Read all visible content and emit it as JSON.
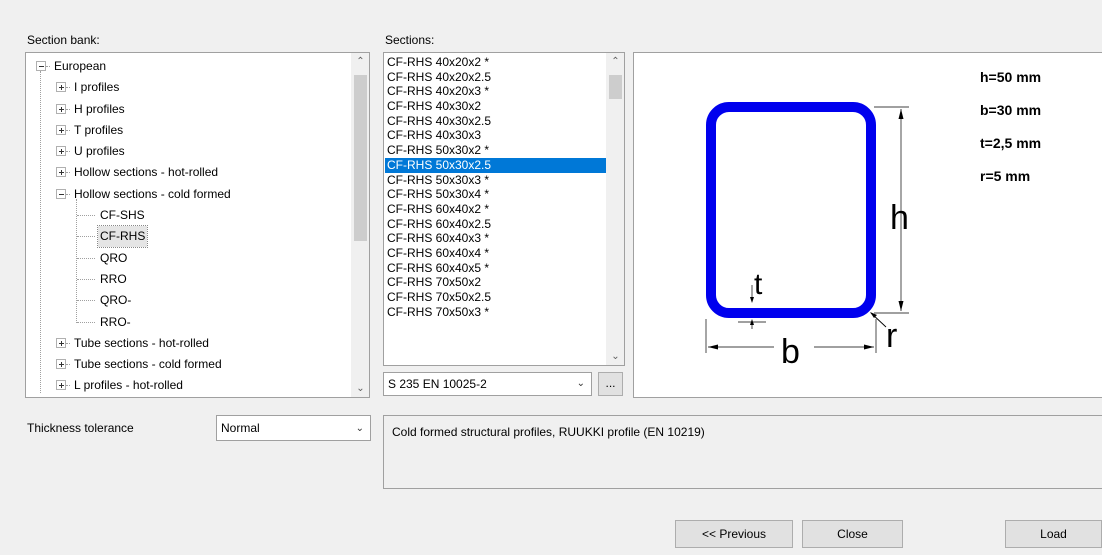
{
  "section_bank": {
    "label": "Section bank:",
    "tree": [
      {
        "label": "European",
        "level": 0,
        "toggle": "minus"
      },
      {
        "label": "I profiles",
        "level": 1,
        "toggle": "plus"
      },
      {
        "label": "H profiles",
        "level": 1,
        "toggle": "plus"
      },
      {
        "label": "T profiles",
        "level": 1,
        "toggle": "plus"
      },
      {
        "label": "U profiles",
        "level": 1,
        "toggle": "plus"
      },
      {
        "label": "Hollow sections - hot-rolled",
        "level": 1,
        "toggle": "plus"
      },
      {
        "label": "Hollow sections - cold formed",
        "level": 1,
        "toggle": "minus"
      },
      {
        "label": "CF-SHS",
        "level": 2,
        "toggle": "none"
      },
      {
        "label": "CF-RHS",
        "level": 2,
        "toggle": "none",
        "selected": true
      },
      {
        "label": "QRO",
        "level": 2,
        "toggle": "none"
      },
      {
        "label": "RRO",
        "level": 2,
        "toggle": "none"
      },
      {
        "label": "QRO-",
        "level": 2,
        "toggle": "none"
      },
      {
        "label": "RRO-",
        "level": 2,
        "toggle": "none"
      },
      {
        "label": "Tube sections - hot-rolled",
        "level": 1,
        "toggle": "plus"
      },
      {
        "label": "Tube sections - cold formed",
        "level": 1,
        "toggle": "plus"
      },
      {
        "label": "L profiles - hot-rolled",
        "level": 1,
        "toggle": "plus"
      }
    ]
  },
  "sections": {
    "label": "Sections:",
    "items": [
      "CF-RHS 40x20x2 *",
      "CF-RHS 40x20x2.5",
      "CF-RHS 40x20x3 *",
      "CF-RHS 40x30x2",
      "CF-RHS 40x30x2.5",
      "CF-RHS 40x30x3",
      "CF-RHS 50x30x2 *",
      "CF-RHS 50x30x2.5",
      "CF-RHS 50x30x3 *",
      "CF-RHS 50x30x4 *",
      "CF-RHS 60x40x2 *",
      "CF-RHS 60x40x2.5",
      "CF-RHS 60x40x3 *",
      "CF-RHS 60x40x4 *",
      "CF-RHS 60x40x5 *",
      "CF-RHS 70x50x2",
      "CF-RHS 70x50x2.5",
      "CF-RHS 70x50x3 *"
    ],
    "selected_index": 7
  },
  "material": {
    "value": "S 235 EN 10025-2",
    "more_label": "..."
  },
  "preview": {
    "dims": [
      "h=50 mm",
      "b=30 mm",
      "t=2,5 mm",
      "r=5 mm"
    ],
    "labels": {
      "h": "h",
      "b": "b",
      "t": "t",
      "r": "r"
    },
    "profile_color": "#0000ee"
  },
  "thickness": {
    "label": "Thickness tolerance",
    "value": "Normal"
  },
  "description": "Cold formed structural profiles, RUUKKI profile (EN 10219)",
  "buttons": {
    "previous": "<< Previous",
    "close": "Close",
    "load": "Load"
  }
}
